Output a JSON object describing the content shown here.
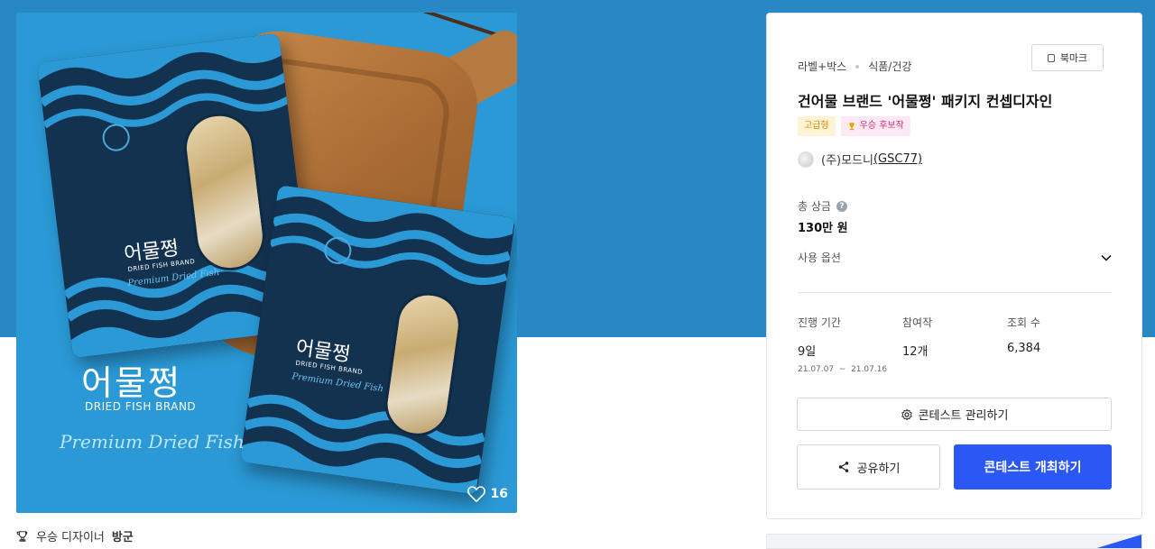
{
  "product": {
    "pouch_title": "어물쩡",
    "pouch_brand": "DRIED FISH BRAND",
    "pouch_script": "Premium Dried Fish",
    "brand_name": "어물쩡",
    "brand_en": "DRIED FISH BRAND",
    "brand_script": "Premium Dried Fish",
    "like_count": "16"
  },
  "designer": {
    "prefix": "우승 디자이너",
    "name": "방군"
  },
  "panel": {
    "breadcrumb": [
      "라벨+박스",
      "식품/건강"
    ],
    "bookmark_label": "북마크",
    "title": "건어물 브랜드 '어물쩡' 패키지 컨셉디자인",
    "badges": {
      "grade": "고급형",
      "award": "우승 후보작"
    },
    "company": {
      "name": "(주)모드니",
      "link": "(GSC77)"
    },
    "prize": {
      "label": "총 상금",
      "value": "130만 원"
    },
    "usage_label": "사용 옵션",
    "stats": [
      {
        "label": "진행 기간",
        "value": "9일",
        "dates": "21.07.07  ~  21.07.16"
      },
      {
        "label": "참여작",
        "value": "12개"
      },
      {
        "label": "조회 수",
        "value": "6,384"
      }
    ],
    "buttons": {
      "manage": "콘테스트 관리하기",
      "share": "공유하기",
      "host": "콘테스트 개최하기"
    }
  },
  "colors": {
    "hero_bg": "#2888c6",
    "image_bg": "#2a99d6",
    "primary": "#2b57f5"
  }
}
